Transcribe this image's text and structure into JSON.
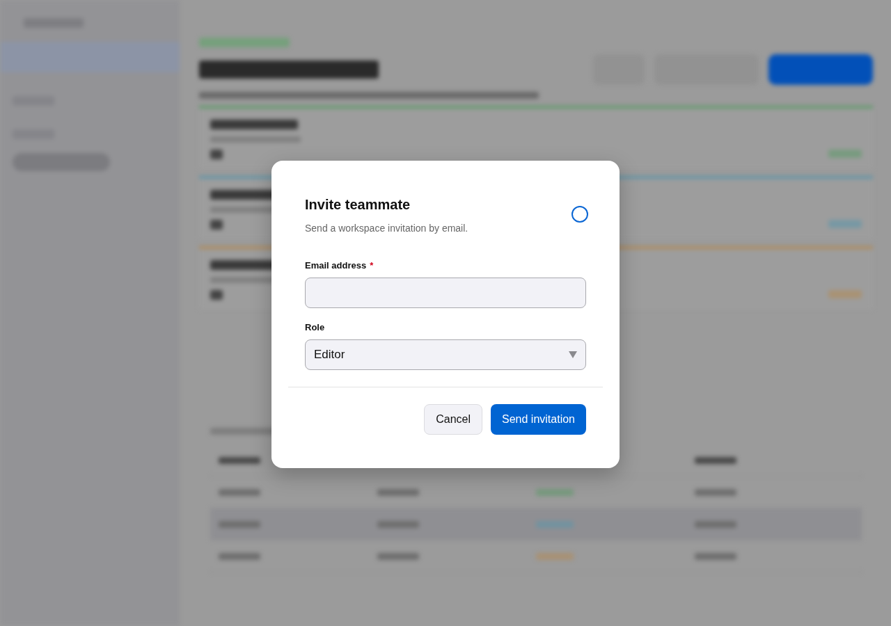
{
  "background": {
    "kind": "blurred"
  },
  "dialog": {
    "title": "Invite teammate",
    "subtitle": "Send a workspace invitation by email.",
    "fields": [
      {
        "kind": "text",
        "label": "Email address",
        "required_mark": "*"
      },
      {
        "kind": "select",
        "label": "Role",
        "value": "Editor"
      }
    ],
    "buttons": [
      {
        "label": "Cancel",
        "kind": "secondary"
      },
      {
        "label": "Send invitation",
        "kind": "primary"
      }
    ]
  }
}
